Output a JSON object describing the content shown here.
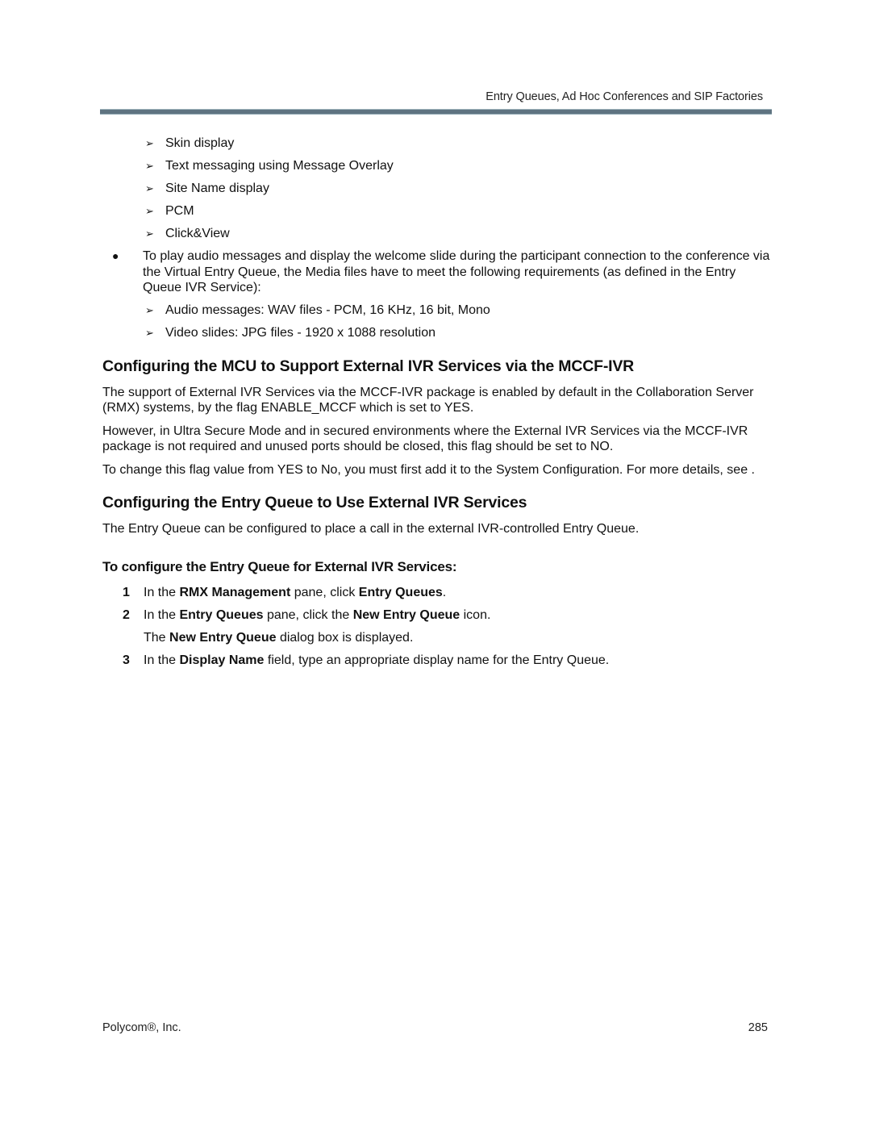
{
  "header": {
    "running_title": "Entry Queues, Ad Hoc Conferences and SIP Factories",
    "rule_color": "#5f7481"
  },
  "top_list": {
    "items": [
      "Skin display",
      "Text messaging using Message Overlay",
      "Site Name display",
      "PCM",
      "Click&View"
    ]
  },
  "bullet": {
    "text": "To play audio messages and display the welcome slide during the participant connection to the conference via the Virtual Entry Queue, the Media files have to meet the following requirements (as defined in the Entry Queue IVR Service):",
    "sub_items": [
      "Audio messages: WAV files - PCM, 16 KHz, 16 bit, Mono",
      "Video slides: JPG files - 1920 x 1088 resolution"
    ]
  },
  "section1": {
    "heading": "Configuring the MCU to Support External IVR Services via the MCCF-IVR",
    "paragraphs": [
      "The support of External IVR Services via the MCCF-IVR package is enabled by default in the Collaboration Server (RMX) systems, by the flag ENABLE_MCCF which is set to YES.",
      "However, in Ultra Secure Mode and in secured environments where the External IVR Services via the MCCF-IVR package is not required and unused ports should be closed, this flag should be set to NO.",
      "To change this flag value from YES to No, you must first add it to the System Configuration. For more details, see ."
    ]
  },
  "section2": {
    "heading": "Configuring the Entry Queue to Use External IVR Services",
    "paragraph": "The Entry Queue can be configured to place a call in the external IVR-controlled Entry Queue.",
    "procedure_heading": "To configure the Entry Queue for External IVR Services:",
    "steps": [
      {
        "num": "1",
        "t1": "In the ",
        "b1": "RMX Management",
        "t2": " pane, click ",
        "b2": "Entry Queues",
        "t3": "."
      },
      {
        "num": "2",
        "t1": "In the ",
        "b1": "Entry Queues",
        "t2": " pane, click the ",
        "b2": "New Entry Queue",
        "t3": " icon."
      },
      {
        "num": "3",
        "t1": "In the ",
        "b1": "Display Name",
        "t2": " field, type an appropriate display name for the Entry Queue.",
        "b2": "",
        "t3": ""
      }
    ],
    "step2_note": {
      "t1": "The ",
      "b1": "New Entry Queue",
      "t2": " dialog box is displayed."
    }
  },
  "footer": {
    "company": "Polycom®, Inc.",
    "page_number": "285"
  },
  "icons": {
    "arrow_bullet": "➢",
    "round_bullet": "●"
  }
}
